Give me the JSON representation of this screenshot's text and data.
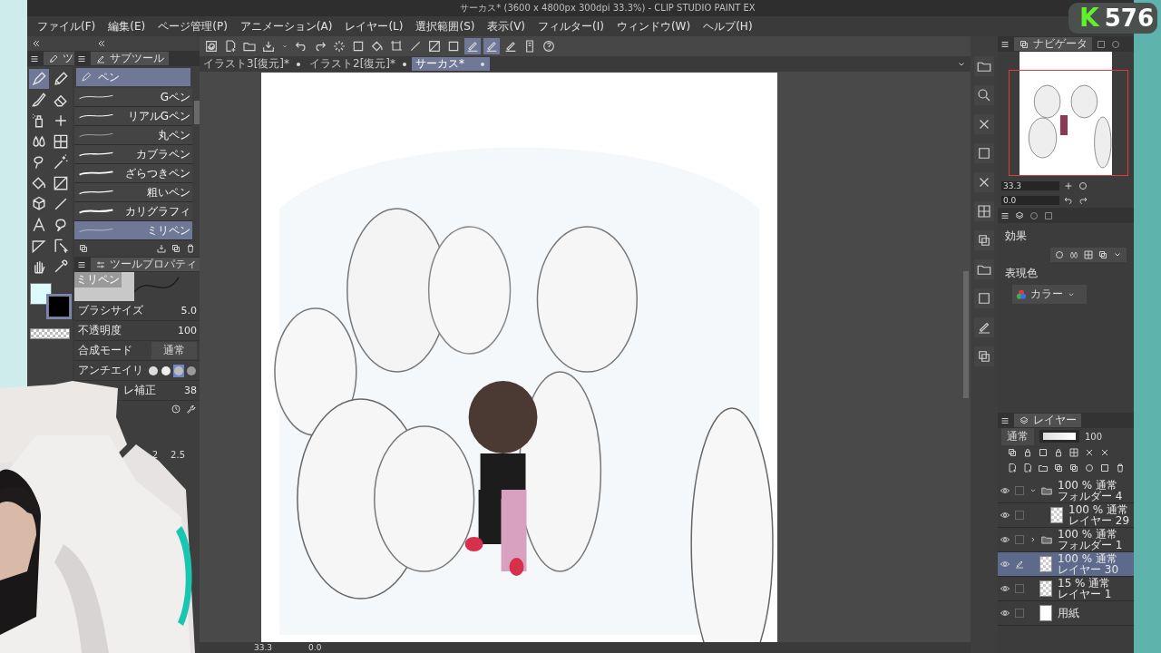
{
  "window": {
    "title": "サーカス* (3600 x 4800px 300dpi 33.3%)  - CLIP STUDIO PAINT EX"
  },
  "menu": [
    "ファイル(F)",
    "編集(E)",
    "ページ管理(P)",
    "アニメーション(A)",
    "レイヤー(L)",
    "選択範囲(S)",
    "表示(V)",
    "フィルター(I)",
    "ウィンドウ(W)",
    "ヘルプ(H)"
  ],
  "toolbox": {
    "tab": "ツ"
  },
  "colors": [
    {
      "color": "#dcfcfb",
      "selected": false
    },
    {
      "color": "#000000",
      "selected": true
    }
  ],
  "subtool": {
    "tab": "サブツール",
    "group": "ペン",
    "brushes": [
      {
        "name": "Gペン",
        "selected": false
      },
      {
        "name": "リアルGペン",
        "selected": false
      },
      {
        "name": "丸ペン",
        "selected": false
      },
      {
        "name": "カブラペン",
        "selected": false
      },
      {
        "name": "ざらつきペン",
        "selected": false
      },
      {
        "name": "粗いペン",
        "selected": false
      },
      {
        "name": "カリグラフィ",
        "selected": false
      },
      {
        "name": "ミリペン",
        "selected": true
      }
    ]
  },
  "tool_property": {
    "tab": "ツールプロパティ",
    "brush": "ミリペン",
    "size_label": "ブラシサイズ",
    "size": "5.0",
    "opacity_label": "不透明度",
    "opacity": "100",
    "blend_label": "合成モード",
    "blend": "通常",
    "antialias_label": "アンチエイリ",
    "antialias": [
      {
        "selected": false
      },
      {
        "selected": false
      },
      {
        "selected": true
      },
      {
        "selected": false
      }
    ],
    "stabilization_label": "レ補正",
    "stabilization": "38"
  },
  "presets": [
    "2",
    "2.5"
  ],
  "document_tabs": [
    {
      "label": "イラスト3[復元]*",
      "selected": false
    },
    {
      "label": "イラスト2[復元]*",
      "selected": false
    },
    {
      "label": "サーカス*",
      "selected": true
    }
  ],
  "navigator": {
    "tab": "ナビゲータ",
    "zoom": "33.3",
    "angle": "0.0"
  },
  "layer_property": {
    "effect_label": "効果",
    "color_label": "表現色",
    "color_mode": "カラー"
  },
  "layers_panel": {
    "tab": "レイヤー",
    "blend_mode": "通常",
    "opacity": "100",
    "opacity_slider": {
      "level": 1
    },
    "layers": [
      {
        "kind": "folder",
        "mode": "100 % 通常",
        "name": "フォルダー 4",
        "visible": true,
        "expanded": true,
        "selected": false,
        "children": [
          {
            "kind": "raster",
            "mode": "100 % 通常",
            "name": "レイヤー 29",
            "visible": true,
            "selected": false
          }
        ]
      },
      {
        "kind": "folder",
        "mode": "100 % 通常",
        "name": "フォルダー 1",
        "visible": true,
        "expanded": false,
        "selected": false
      },
      {
        "kind": "raster",
        "mode": "100 % 通常",
        "name": "レイヤー 30",
        "visible": true,
        "selected": true
      },
      {
        "kind": "raster",
        "mode": "15 % 通常",
        "name": "レイヤー 1",
        "visible": true,
        "selected": false
      },
      {
        "kind": "paper",
        "name": "用紙",
        "visible": true,
        "selected": false
      }
    ]
  },
  "status_bar": {
    "zoom": "33.3",
    "angle": "0.0"
  },
  "stream_badge": {
    "letter": "K",
    "count": "576"
  }
}
